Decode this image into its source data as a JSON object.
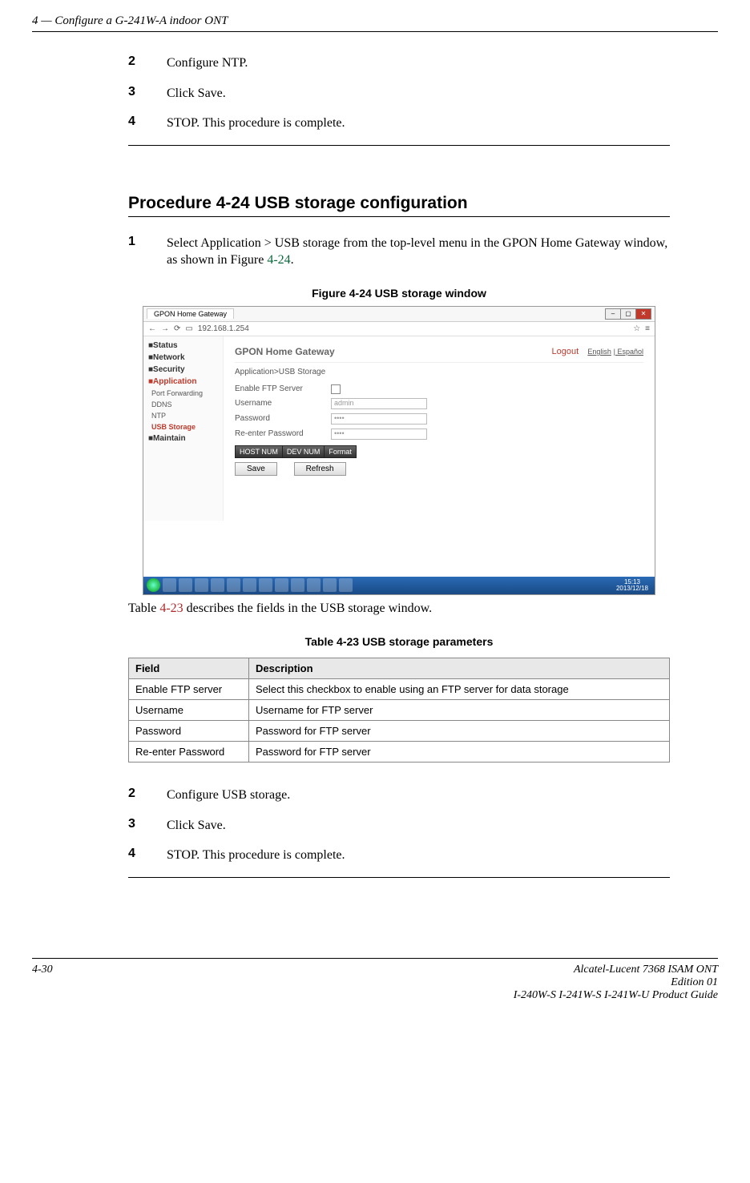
{
  "header": {
    "chapter": "4 —  Configure a G-241W-A indoor ONT"
  },
  "steps_top": [
    {
      "n": "2",
      "t": "Configure NTP."
    },
    {
      "n": "3",
      "t": "Click Save."
    },
    {
      "n": "4",
      "t": "STOP. This procedure is complete."
    }
  ],
  "procedure": {
    "title": "Procedure 4-24  USB storage configuration"
  },
  "step1": {
    "n": "1",
    "t_before": "Select Application > USB storage from the top-level menu in the GPON Home Gateway window, as shown in Figure ",
    "ref": "4-24",
    "t_after": "."
  },
  "figure": {
    "caption": "Figure 4-24  USB storage window",
    "tab_label": "GPON Home Gateway",
    "address": "192.168.1.254",
    "star": "☆",
    "menu": "≡",
    "mp_title": "GPON Home Gateway",
    "logout": "Logout",
    "lang1": "English",
    "lang2": "Español",
    "crumb": "Application>USB Storage",
    "sidebar": [
      "Status",
      "Network",
      "Security",
      "Application",
      "Port Forwarding",
      "DDNS",
      "NTP",
      "USB Storage",
      "Maintain"
    ],
    "rows": [
      {
        "label": "Enable FTP Server",
        "type": "cb",
        "val": ""
      },
      {
        "label": "Username",
        "type": "text",
        "val": "admin"
      },
      {
        "label": "Password",
        "type": "text",
        "val": "••••"
      },
      {
        "label": "Re-enter Password",
        "type": "text",
        "val": "••••"
      }
    ],
    "tbtns": [
      "HOST NUM",
      "DEV NUM",
      "Format"
    ],
    "save": "Save",
    "refresh": "Refresh",
    "clock_time": "15:13",
    "clock_date": "2013/12/18"
  },
  "after_fig": {
    "before": "Table ",
    "ref": "4-23",
    "after": " describes the fields in the USB storage window."
  },
  "table": {
    "caption": "Table 4-23 USB storage parameters",
    "head": [
      "Field",
      "Description"
    ],
    "rows": [
      [
        "Enable FTP server",
        "Select this checkbox to enable using an FTP server for data storage"
      ],
      [
        "Username",
        "Username for FTP server"
      ],
      [
        "Password",
        "Password for FTP server"
      ],
      [
        "Re-enter Password",
        "Password for FTP server"
      ]
    ]
  },
  "steps_bottom": [
    {
      "n": "2",
      "t": "Configure USB storage."
    },
    {
      "n": "3",
      "t": "Click Save."
    },
    {
      "n": "4",
      "t": "STOP. This procedure is complete."
    }
  ],
  "footer": {
    "page": "4-30",
    "r1": "Alcatel-Lucent 7368 ISAM ONT",
    "r2": "Edition 01",
    "r3": "I-240W-S I-241W-S I-241W-U Product Guide"
  }
}
